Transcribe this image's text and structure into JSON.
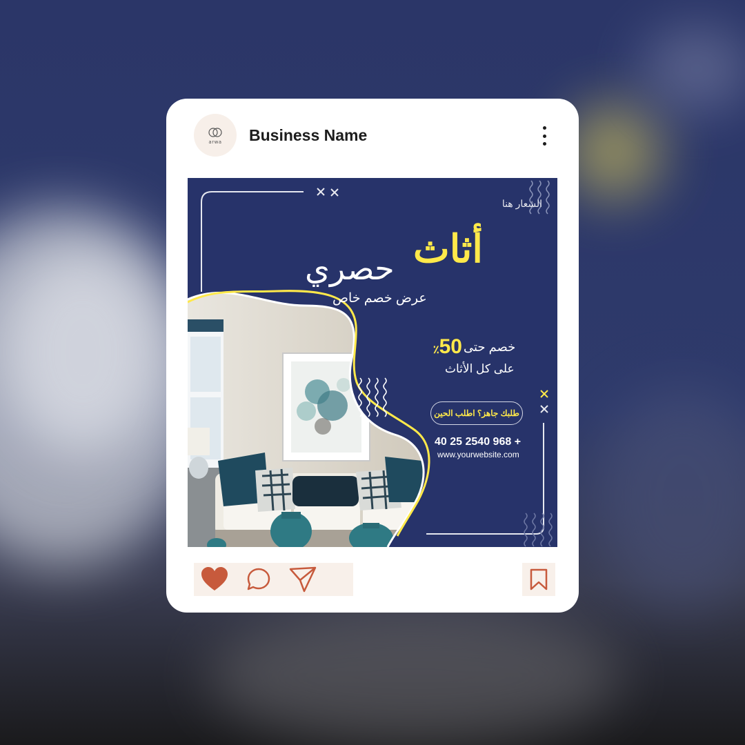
{
  "post": {
    "avatar_logo_text": "arwa",
    "business_name": "Business Name"
  },
  "ad": {
    "logo_here": "الشعار هنا",
    "headline_yellow": "أثاث",
    "headline_white": "حصري",
    "subheadline": "عرض خصم خاص",
    "discount_prefix": "خصم حتى",
    "discount_value": "50",
    "discount_unit": "٪",
    "discount_line2": "على كل الأثاث",
    "cta_label": "طلبك جاهز؟ اطلب الحين",
    "phone": "+ 968 2540 25 40",
    "website": "www.yourwebsite.com"
  },
  "colors": {
    "navy": "#27336a",
    "yellow": "#ffe94a",
    "accent_icon": "#c75a3c",
    "action_bg": "#f8f0ea"
  },
  "actions": {
    "icons": [
      "heart-icon",
      "comment-icon",
      "share-icon",
      "bookmark-icon"
    ]
  }
}
